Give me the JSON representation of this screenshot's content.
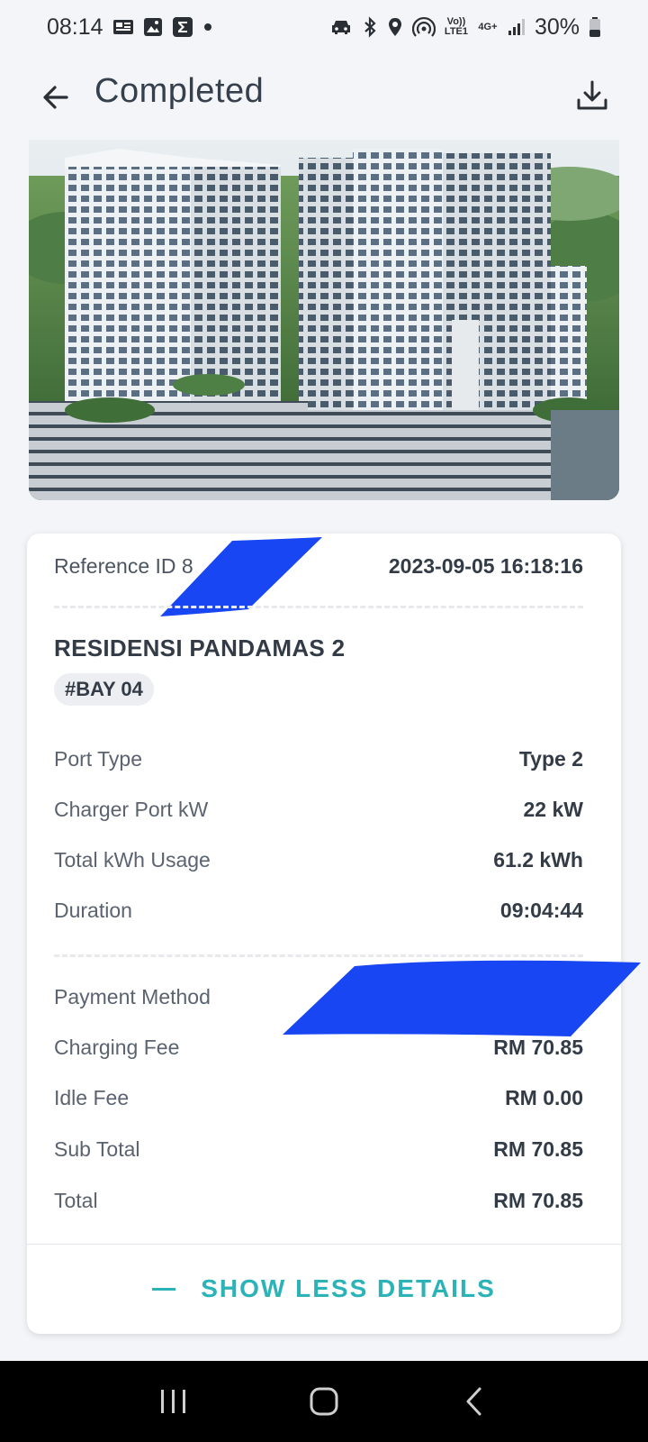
{
  "status_bar": {
    "time": "08:14",
    "battery": "30%",
    "icons": [
      "news-icon",
      "image-icon",
      "sigma-icon",
      "dot-icon",
      "car-icon",
      "bluetooth-icon",
      "location-icon",
      "hotspot-icon",
      "volte-icon",
      "4g-icon",
      "signal-icon",
      "battery-icon"
    ],
    "volte_label": "Vo)) LTE1",
    "net_label": "4G+"
  },
  "app_bar": {
    "title": "Completed"
  },
  "card": {
    "reference_label": "Reference ID",
    "reference_visible": "8",
    "timestamp": "2023-09-05 16:18:16",
    "station_name": "RESIDENSI PANDAMAS 2",
    "bay": "#BAY 04",
    "details": [
      {
        "label": "Port Type",
        "value": "Type 2"
      },
      {
        "label": "Charger Port kW",
        "value": "22 kW"
      },
      {
        "label": "Total kWh Usage",
        "value": "61.2 kWh"
      },
      {
        "label": "Duration",
        "value": "09:04:44"
      }
    ],
    "payment": [
      {
        "label": "Payment Method",
        "value": ""
      },
      {
        "label": "Charging Fee",
        "value": "RM 70.85"
      },
      {
        "label": "Idle Fee",
        "value": "RM 0.00"
      },
      {
        "label": "Sub Total",
        "value": "RM 70.85"
      },
      {
        "label": "Total",
        "value": "RM 70.85"
      }
    ],
    "toggle_label": "SHOW LESS DETAILS"
  },
  "colors": {
    "accent": "#2bb3b8",
    "redaction": "#1746f2",
    "background": "#f3f5f8"
  }
}
